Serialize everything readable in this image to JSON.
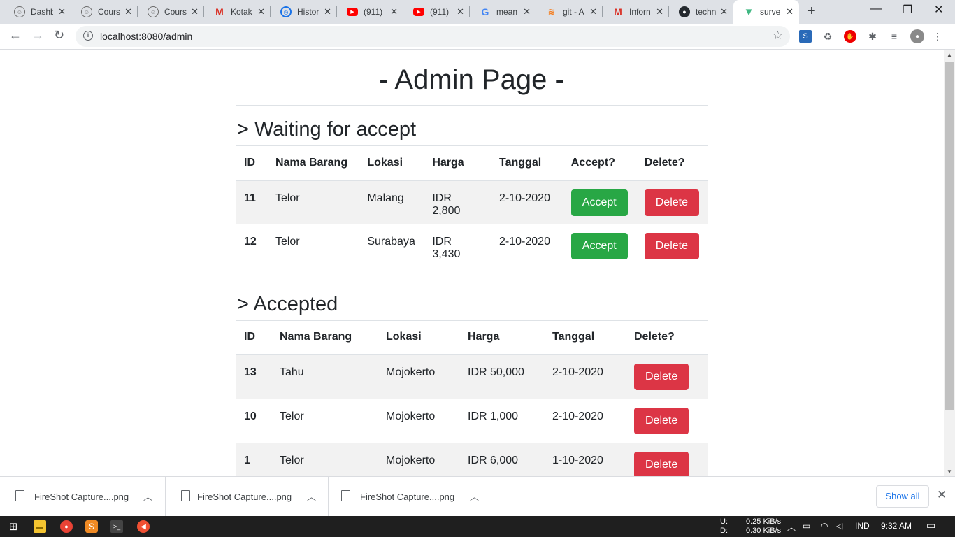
{
  "browser": {
    "tabs": [
      {
        "title": "Dashb",
        "icon": "moodle-icon"
      },
      {
        "title": "Cours",
        "icon": "moodle-icon"
      },
      {
        "title": "Cours",
        "icon": "moodle-icon"
      },
      {
        "title": "Kotak",
        "icon": "gmail-icon"
      },
      {
        "title": "Histor",
        "icon": "history-icon"
      },
      {
        "title": "(911)",
        "icon": "youtube-icon"
      },
      {
        "title": "(911)",
        "icon": "youtube-icon"
      },
      {
        "title": "mean",
        "icon": "google-icon"
      },
      {
        "title": "git - A",
        "icon": "stackoverflow-icon"
      },
      {
        "title": "Inforn",
        "icon": "gmail-icon"
      },
      {
        "title": "techn",
        "icon": "github-icon"
      },
      {
        "title": "surve",
        "icon": "vue-icon",
        "active": true
      }
    ],
    "url": "localhost:8080/admin"
  },
  "page": {
    "title": "- Admin Page -",
    "waiting": {
      "heading": "> Waiting for accept",
      "columns": [
        "ID",
        "Nama Barang",
        "Lokasi",
        "Harga",
        "Tanggal",
        "Accept?",
        "Delete?"
      ],
      "rows": [
        {
          "id": "11",
          "nama": "Telor",
          "lokasi": "Malang",
          "harga": "IDR 2,800",
          "tanggal": "2-10-2020",
          "accept_label": "Accept",
          "delete_label": "Delete"
        },
        {
          "id": "12",
          "nama": "Telor",
          "lokasi": "Surabaya",
          "harga": "IDR 3,430",
          "tanggal": "2-10-2020",
          "accept_label": "Accept",
          "delete_label": "Delete"
        }
      ]
    },
    "accepted": {
      "heading": "> Accepted",
      "columns": [
        "ID",
        "Nama Barang",
        "Lokasi",
        "Harga",
        "Tanggal",
        "Delete?"
      ],
      "rows": [
        {
          "id": "13",
          "nama": "Tahu",
          "lokasi": "Mojokerto",
          "harga": "IDR 50,000",
          "tanggal": "2-10-2020",
          "delete_label": "Delete"
        },
        {
          "id": "10",
          "nama": "Telor",
          "lokasi": "Mojokerto",
          "harga": "IDR 1,000",
          "tanggal": "2-10-2020",
          "delete_label": "Delete"
        },
        {
          "id": "1",
          "nama": "Telor",
          "lokasi": "Mojokerto",
          "harga": "IDR 6,000",
          "tanggal": "1-10-2020",
          "delete_label": "Delete"
        }
      ]
    }
  },
  "downloads": {
    "items": [
      "FireShot Capture....png",
      "FireShot Capture....png",
      "FireShot Capture....png"
    ],
    "show_all": "Show all"
  },
  "taskbar": {
    "net_up_label": "U:",
    "net_up": "0.25 KiB/s",
    "net_down_label": "D:",
    "net_down": "0.30 KiB/s",
    "lang": "IND",
    "time": "9:32 AM"
  },
  "colors": {
    "success": "#28a745",
    "danger": "#dc3545",
    "text": "#212529",
    "stripe": "#f2f2f2"
  }
}
